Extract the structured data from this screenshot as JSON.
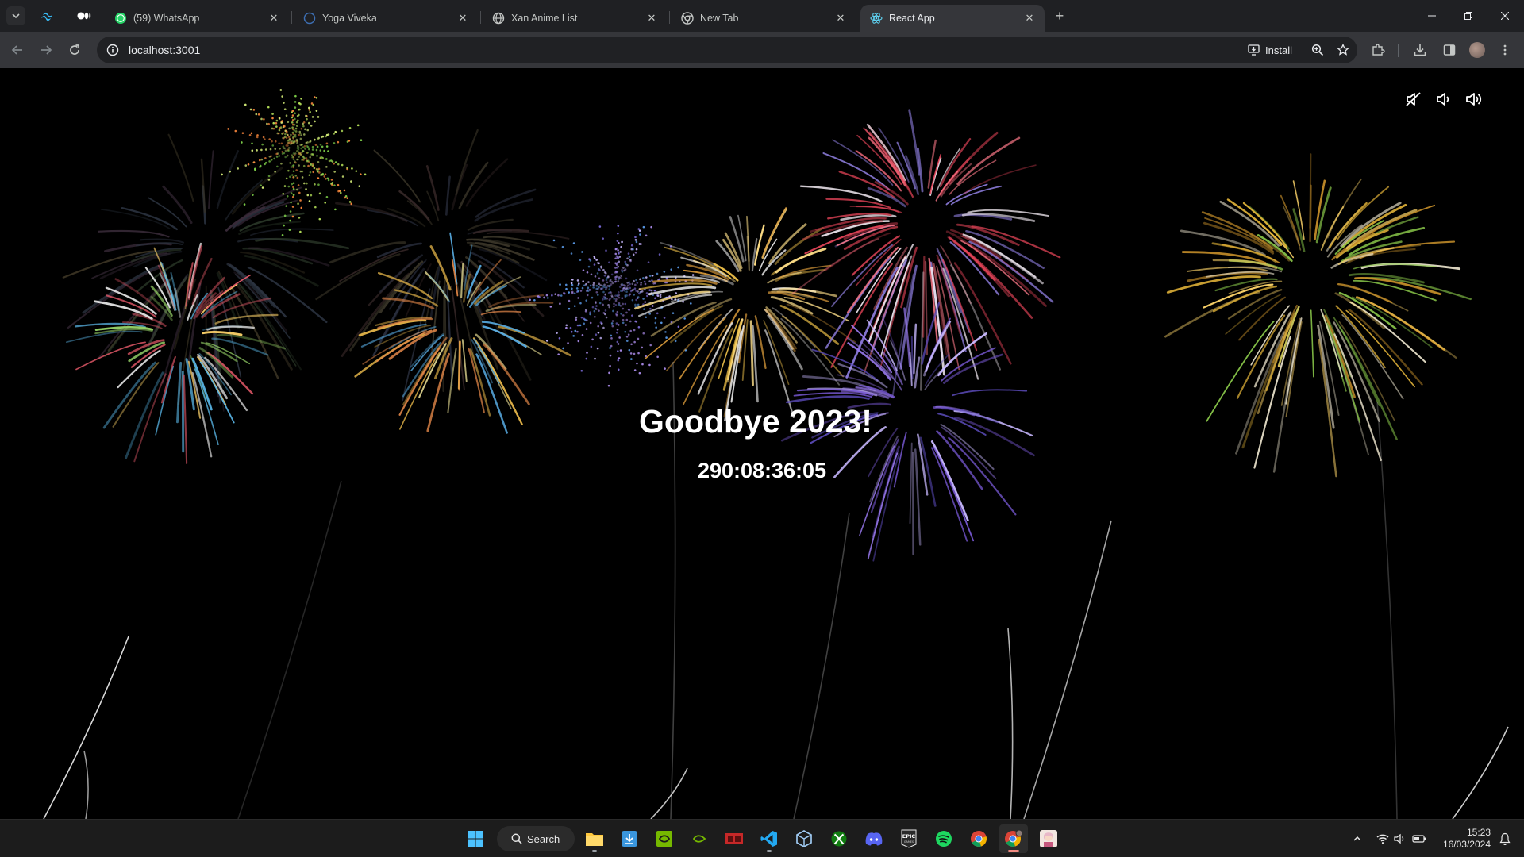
{
  "browser": {
    "tabs": [
      {
        "title": "(59) WhatsApp",
        "icon": "whatsapp-icon"
      },
      {
        "title": "Yoga Viveka",
        "icon": "site-icon"
      },
      {
        "title": "Xan Anime List",
        "icon": "globe-icon"
      },
      {
        "title": "New Tab",
        "icon": "chrome-icon"
      },
      {
        "title": "React App",
        "icon": "react-icon",
        "active": true
      }
    ],
    "address": "localhost:3001",
    "install_label": "Install"
  },
  "page": {
    "headline": "Goodbye 2023!",
    "countdown": "290:08:36:05",
    "sound_controls": [
      "mute-icon",
      "volume-low-icon",
      "volume-high-icon"
    ]
  },
  "taskbar": {
    "search_label": "Search",
    "apps": [
      "start-icon",
      "file-explorer-icon",
      "app-installer-icon",
      "nvidia-icon",
      "geforce-icon",
      "media-app-icon",
      "vscode-icon",
      "virtualbox-icon",
      "xbox-icon",
      "discord-icon",
      "epic-games-icon",
      "spotify-icon",
      "chrome-icon",
      "chrome-profile-icon",
      "anime-app-icon"
    ],
    "time": "15:23",
    "date": "16/03/2024"
  },
  "colors": {
    "tab_strip": "#1f2023",
    "toolbar": "#35363a",
    "omnibox": "#202124",
    "page_bg": "#000000",
    "taskbar": "#1c1c1c"
  }
}
